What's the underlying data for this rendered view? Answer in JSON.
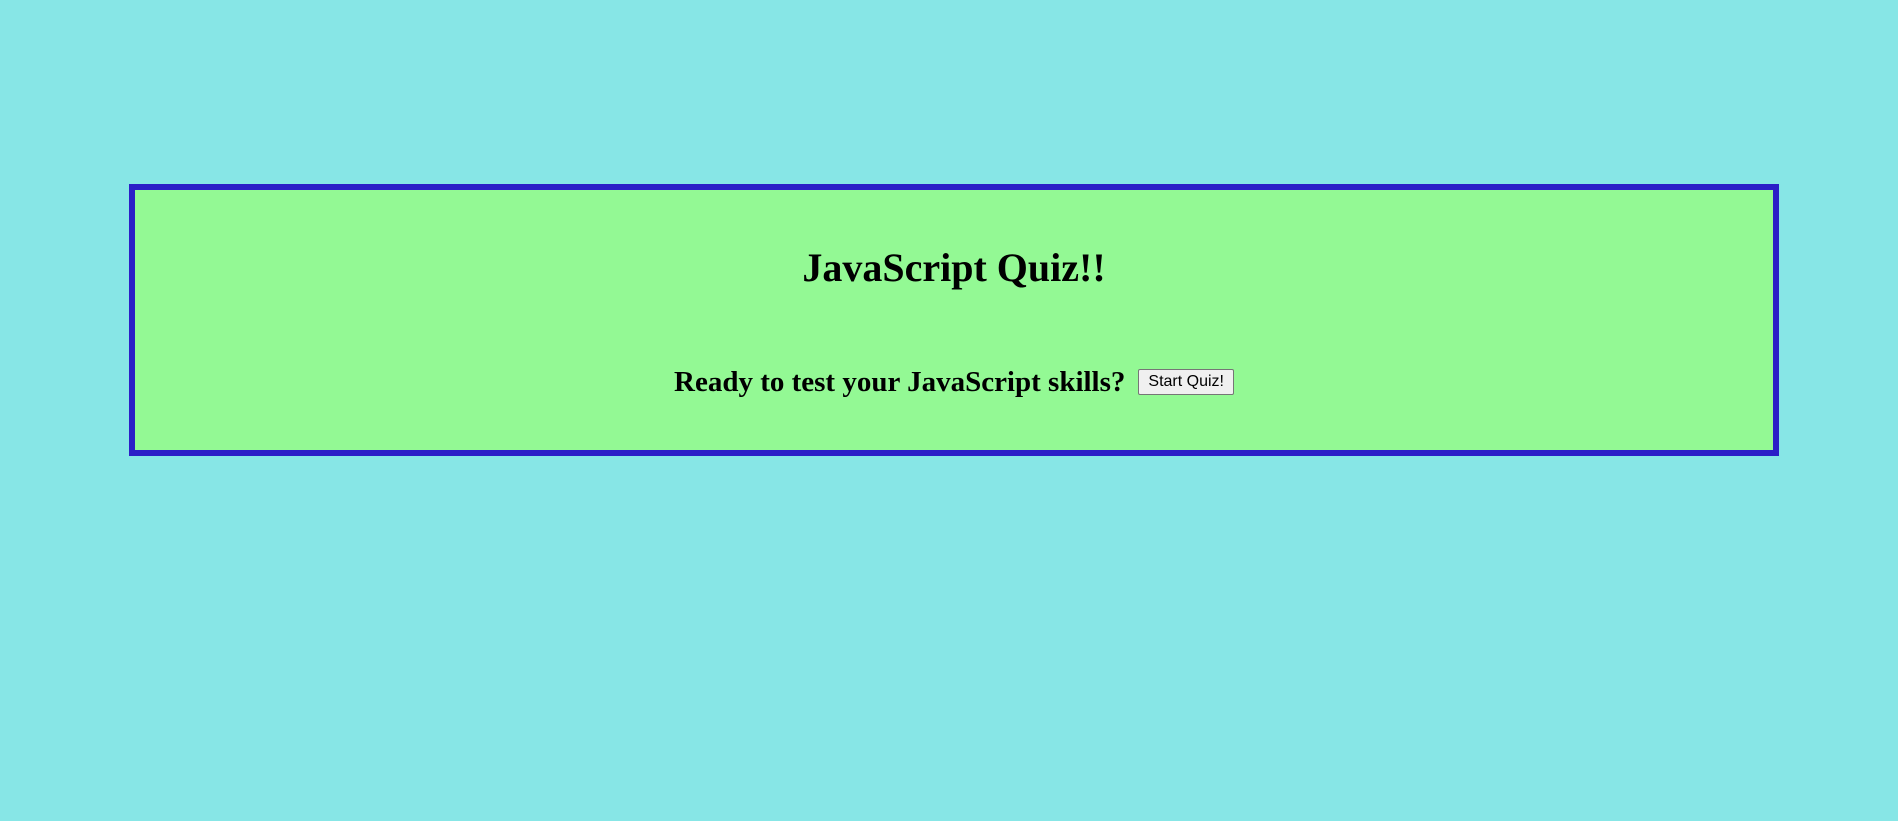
{
  "quiz": {
    "title": "JavaScript Quiz!!",
    "prompt": "Ready to test your JavaScript skills?",
    "start_button_label": "Start Quiz!"
  },
  "colors": {
    "page_background": "#87e6e6",
    "panel_background": "#93f994",
    "panel_border": "#2b1fc7"
  }
}
